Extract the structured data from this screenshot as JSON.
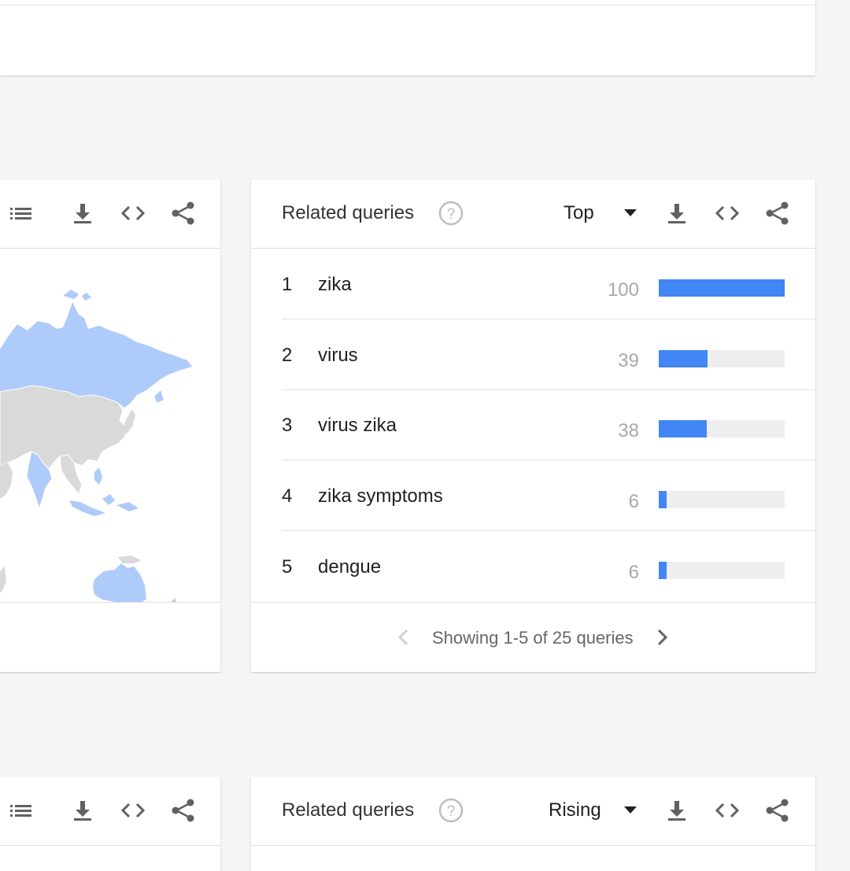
{
  "colors": {
    "accent": "#4285f4",
    "track": "#eeeeee",
    "map_highlight": "#aecbfa",
    "map_land": "#d9d9d9"
  },
  "top_card": {},
  "map_card": {
    "icons": [
      "list-icon",
      "download-icon",
      "embed-icon",
      "share-icon"
    ]
  },
  "related_queries_top": {
    "title": "Related queries",
    "help_icon": "help-circle-icon",
    "selector": "Top",
    "icons": [
      "download-icon",
      "embed-icon",
      "share-icon"
    ],
    "rows": [
      {
        "rank": "1",
        "query": "zika",
        "value": "100",
        "percent": 100
      },
      {
        "rank": "2",
        "query": "virus",
        "value": "39",
        "percent": 39
      },
      {
        "rank": "3",
        "query": "virus zika",
        "value": "38",
        "percent": 38
      },
      {
        "rank": "4",
        "query": "zika symptoms",
        "value": "6",
        "percent": 6
      },
      {
        "rank": "5",
        "query": "dengue",
        "value": "6",
        "percent": 6
      }
    ],
    "pager": {
      "label": "Showing 1-5 of 25 queries",
      "prev_icon": "chevron-left-icon",
      "next_icon": "chevron-right-icon"
    }
  },
  "related_queries_rising": {
    "title": "Related queries",
    "help_icon": "help-circle-icon",
    "selector": "Rising",
    "icons": [
      "download-icon",
      "embed-icon",
      "share-icon"
    ]
  }
}
